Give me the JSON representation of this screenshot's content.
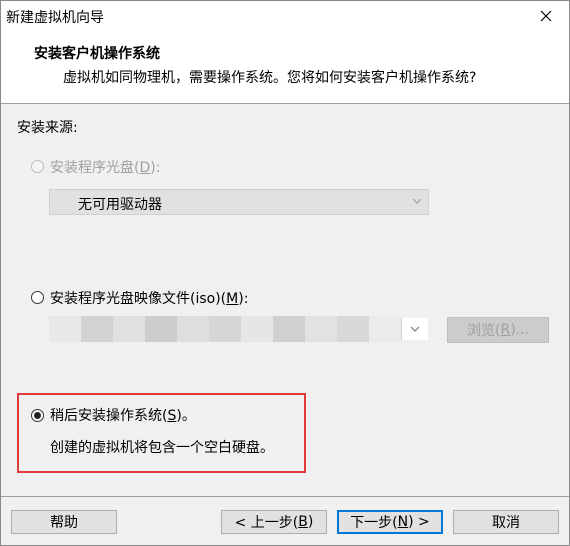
{
  "window": {
    "title": "新建虚拟机向导"
  },
  "header": {
    "title": "安装客户机操作系统",
    "subtitle": "虚拟机如同物理机，需要操作系统。您将如何安装客户机操作系统?"
  },
  "source": {
    "label": "安装来源:",
    "disc": {
      "label_pre": "安装程序光盘(",
      "key": "D",
      "label_post": "):",
      "enabled": false,
      "selected": false
    },
    "disc_select": {
      "value": "无可用驱动器",
      "enabled": false
    },
    "iso": {
      "label_pre": "安装程序光盘映像文件(iso)(",
      "key": "M",
      "label_post": "):",
      "enabled": true,
      "selected": false
    },
    "iso_browse": {
      "label_pre": "浏览(",
      "key": "R",
      "label_post": ")...",
      "enabled": false
    },
    "later": {
      "label_pre": "稍后安装操作系统(",
      "key": "S",
      "label_post": ")。",
      "enabled": true,
      "selected": true
    },
    "later_desc": "创建的虚拟机将包含一个空白硬盘。"
  },
  "footer": {
    "help": "帮助",
    "back": {
      "pre": "< 上一步(",
      "key": "B",
      "post": ")"
    },
    "next": {
      "pre": "下一步(",
      "key": "N",
      "post": ") >"
    },
    "cancel": "取消"
  },
  "colors": {
    "highlight": "#e03a3a",
    "accent": "#0078d7",
    "panel": "#f0f0f0"
  }
}
